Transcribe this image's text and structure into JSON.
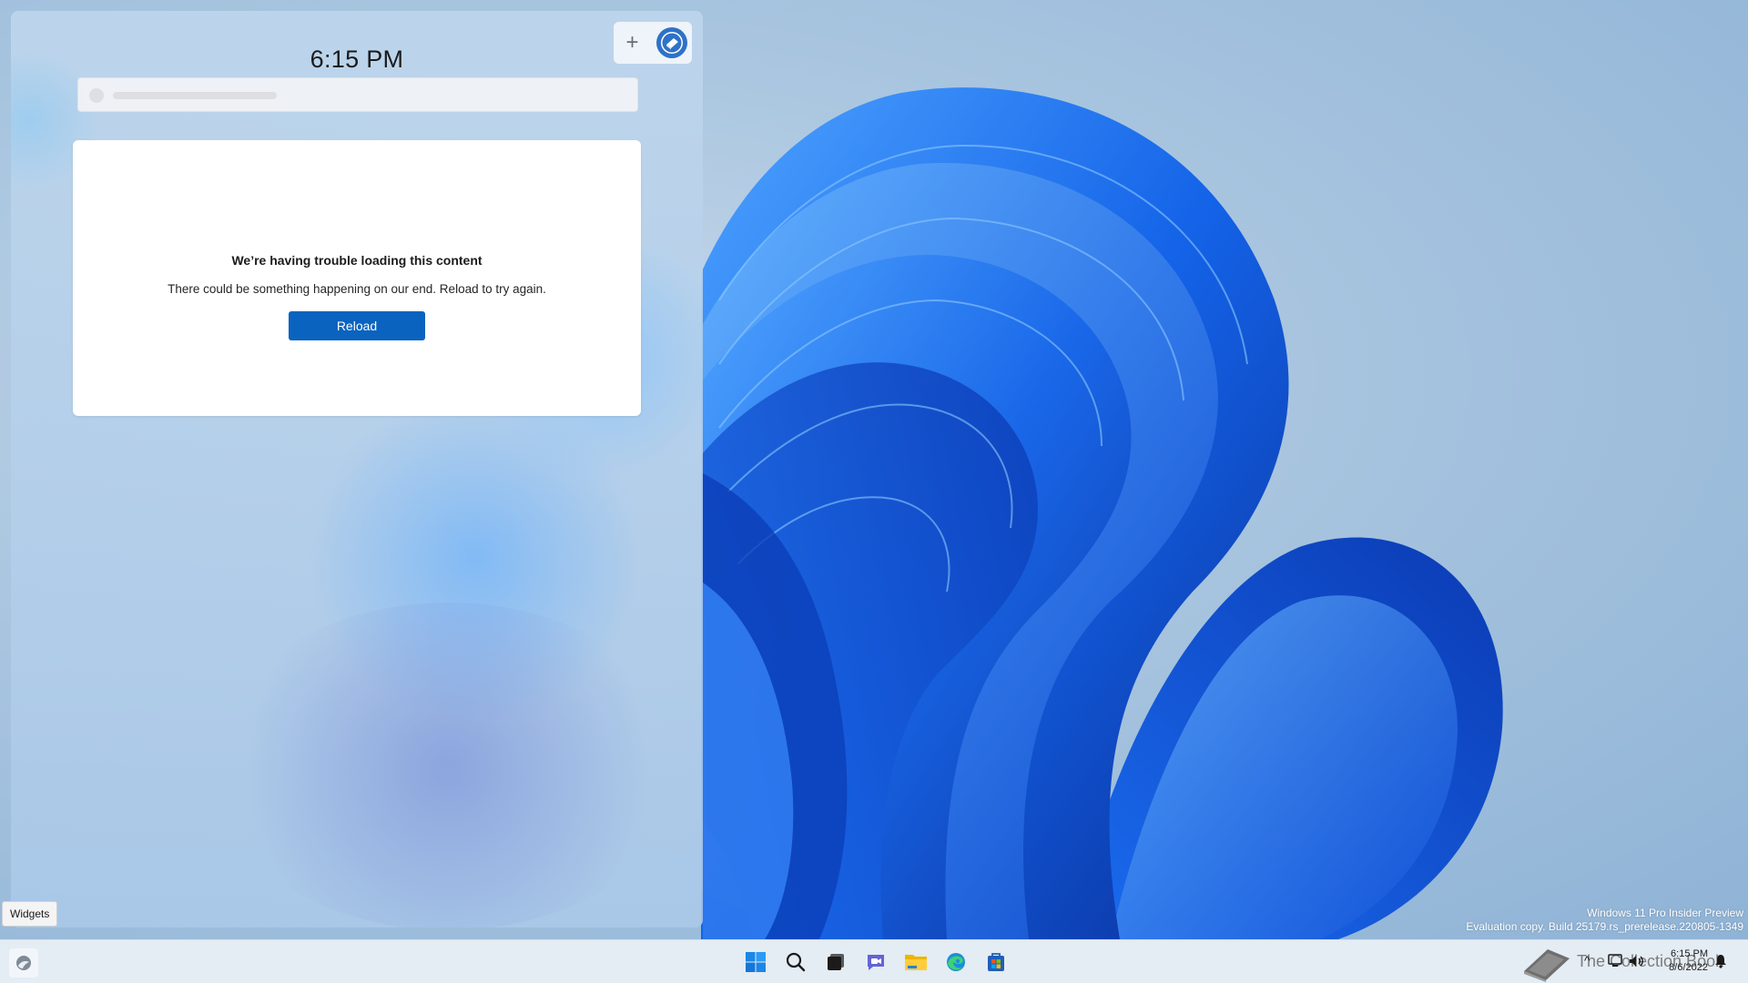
{
  "widgets_panel": {
    "time": "6:15 PM",
    "add_label": "+",
    "error": {
      "title": "We’re having trouble loading this content",
      "description": "There could be something happening on our end. Reload to try again.",
      "reload_label": "Reload"
    }
  },
  "tooltip": "Widgets",
  "watermark": {
    "line1": "Windows 11 Pro Insider Preview",
    "line2": "Evaluation copy. Build 25179.rs_prerelease.220805-1349"
  },
  "taskbar": {
    "icons": [
      "start-icon",
      "search-icon",
      "task-view-icon",
      "chat-icon",
      "file-explorer-icon",
      "edge-icon",
      "store-icon"
    ],
    "tray": {
      "brand": "The Collection Book",
      "chevron": "^",
      "time": "6:15 PM",
      "date": "8/6/2022"
    }
  },
  "colors": {
    "accent": "#0a63bf",
    "bloom": "#1a6cf0"
  }
}
